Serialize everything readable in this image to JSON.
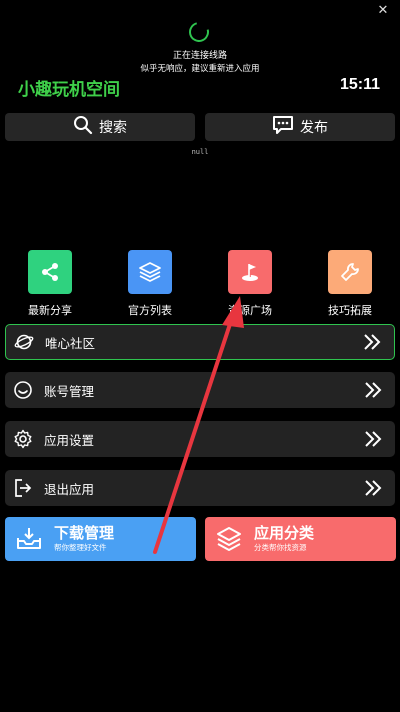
{
  "status": {
    "connecting": "正在连接线路",
    "hint": "似乎无响应，建议重新进入应用"
  },
  "header": {
    "app_title": "小趣玩机空间",
    "time": "15:11"
  },
  "top_buttons": {
    "search": "搜索",
    "publish": "发布"
  },
  "notice": "null",
  "grid": [
    {
      "label": "最新分享",
      "icon": "share-icon",
      "color": "#2fd27f"
    },
    {
      "label": "官方列表",
      "icon": "layers-icon",
      "color": "#4a95f5"
    },
    {
      "label": "资源广场",
      "icon": "flag-icon",
      "color": "#f86b6c"
    },
    {
      "label": "技巧拓展",
      "icon": "wrench-icon",
      "color": "#fcaa78"
    }
  ],
  "menu": [
    {
      "label": "唯心社区",
      "icon": "planet-icon",
      "active": true
    },
    {
      "label": "账号管理",
      "icon": "smile-icon",
      "active": false
    },
    {
      "label": "应用设置",
      "icon": "gear-icon",
      "active": false
    },
    {
      "label": "退出应用",
      "icon": "exit-icon",
      "active": false
    }
  ],
  "cards": {
    "download": {
      "title": "下载管理",
      "subtitle": "帮你整理好文件",
      "color": "#4aa0f3"
    },
    "category": {
      "title": "应用分类",
      "subtitle": "分类帮你找资源",
      "color": "#f86b6c"
    }
  },
  "colors": {
    "accent_green": "#2fc44f",
    "title_green": "#3fd04a",
    "row_bg": "#232323",
    "annotation_arrow": "#e8363f"
  }
}
